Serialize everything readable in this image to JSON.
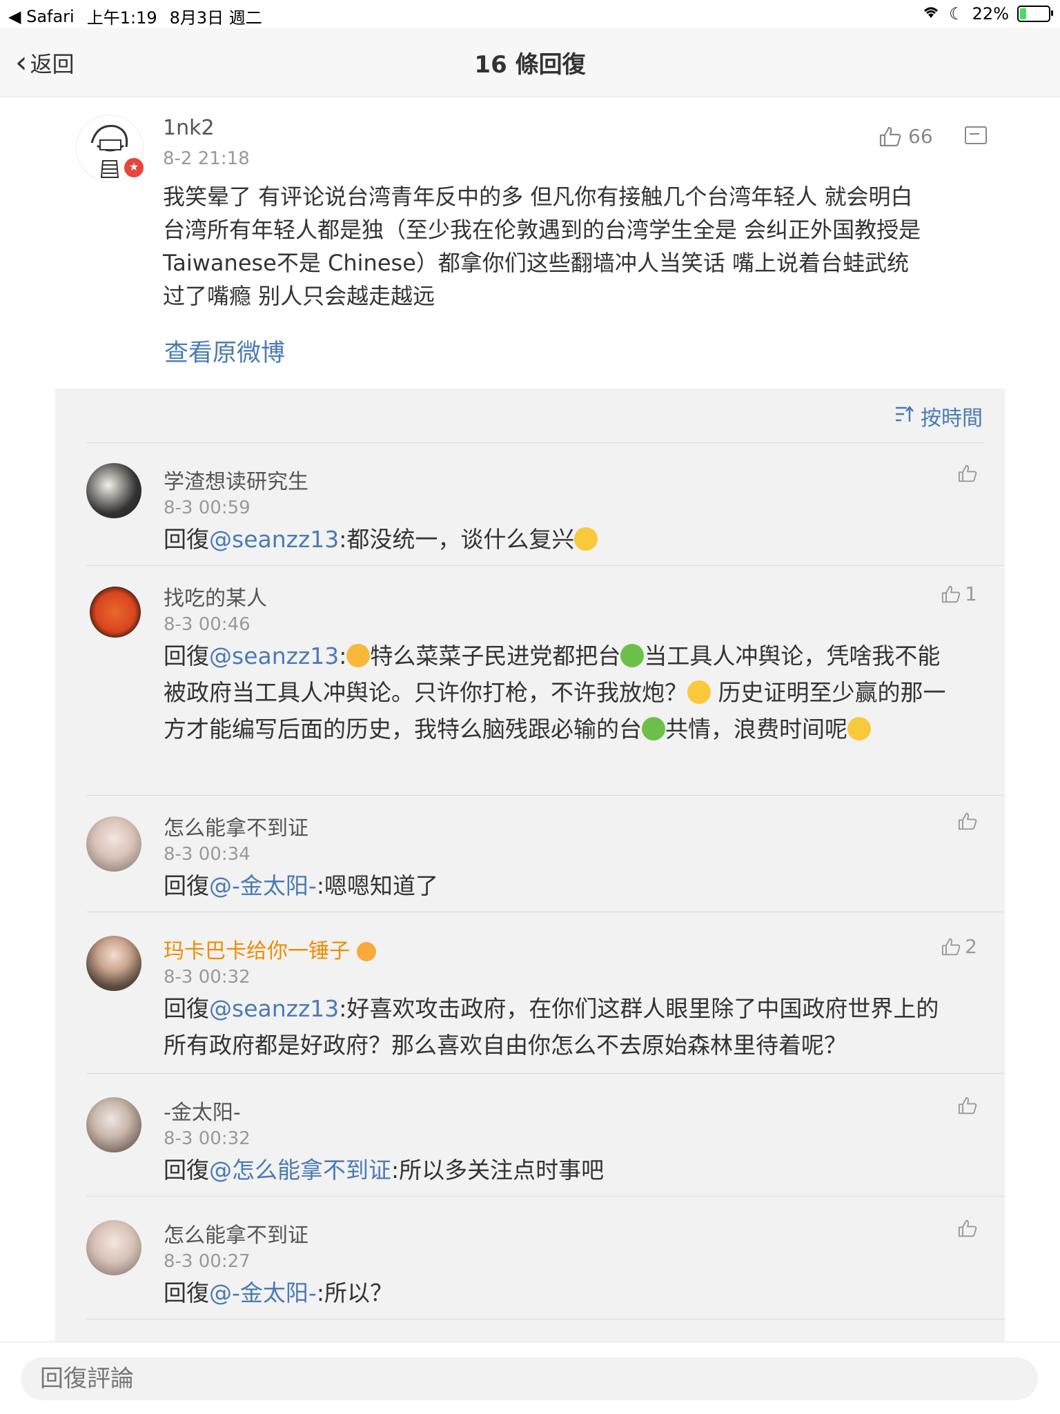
{
  "status_bar": {
    "back_app": "◀ Safari",
    "time": "上午1:19",
    "date": "8月3日 週二",
    "battery": "22%"
  },
  "nav": {
    "back_label": "返回",
    "title": "16 條回復"
  },
  "main_comment": {
    "username": "1nk2",
    "time": "8-2 21:18",
    "likes": "66",
    "text": "我笑晕了 有评论说台湾青年反中的多 但凡你有接触几个台湾年轻人 就会明白台湾所有年轻人都是独（至少我在伦敦遇到的台湾学生全是 会纠正外国教授是Taiwanese不是 Chinese）都拿你们这些翻墙冲人当笑话 嘴上说着台蛙武统过了嘴瘾 别人只会越走越远",
    "view_original": "查看原微博"
  },
  "sort_label": "按時間",
  "replies": [
    {
      "name": "学渣想读研究生",
      "time": "8-3 00:59",
      "likes": "",
      "prefix": "回復",
      "mention": "@seanzz13",
      "text": ":都没统一，谈什么复兴"
    },
    {
      "name": "找吃的某人",
      "time": "8-3 00:46",
      "likes": "1",
      "prefix": "回復",
      "mention": "@seanzz13",
      "text_a": ":",
      "text_b": "特么菜菜子民进党都把台",
      "text_c": "当工具人冲舆论，凭啥我不能被政府当工具人冲舆论。只许你打枪，不许我放炮？",
      "text_d": " 历史证明至少赢的那一方才能编写后面的历史，我特么脑残跟必输的台",
      "text_e": "共情，浪费时间呢"
    },
    {
      "name": "怎么能拿不到证",
      "time": "8-3 00:34",
      "likes": "",
      "prefix": "回復",
      "mention": "@-金太阳-",
      "text": ":嗯嗯知道了"
    },
    {
      "name": "玛卡巴卡给你一锤子",
      "time": "8-3 00:32",
      "likes": "2",
      "prefix": "回復",
      "mention": "@seanzz13",
      "text": ":好喜欢攻击政府，在你们这群人眼里除了中国政府世界上的所有政府都是好政府？那么喜欢自由你怎么不去原始森林里待着呢？"
    },
    {
      "name": "-金太阳-",
      "time": "8-3 00:32",
      "likes": "",
      "prefix": "回復",
      "mention": "@怎么能拿不到证",
      "text": ":所以多关注点时事吧"
    },
    {
      "name": "怎么能拿不到证",
      "time": "8-3 00:27",
      "likes": "",
      "prefix": "回復",
      "mention": "@-金太阳-",
      "text": ":所以？"
    }
  ],
  "bottom": {
    "placeholder": "回復評論"
  },
  "colors": {
    "link": "#4a7ab5",
    "vip_name": "#f08c00",
    "panel_bg": "#f2f2f2"
  }
}
